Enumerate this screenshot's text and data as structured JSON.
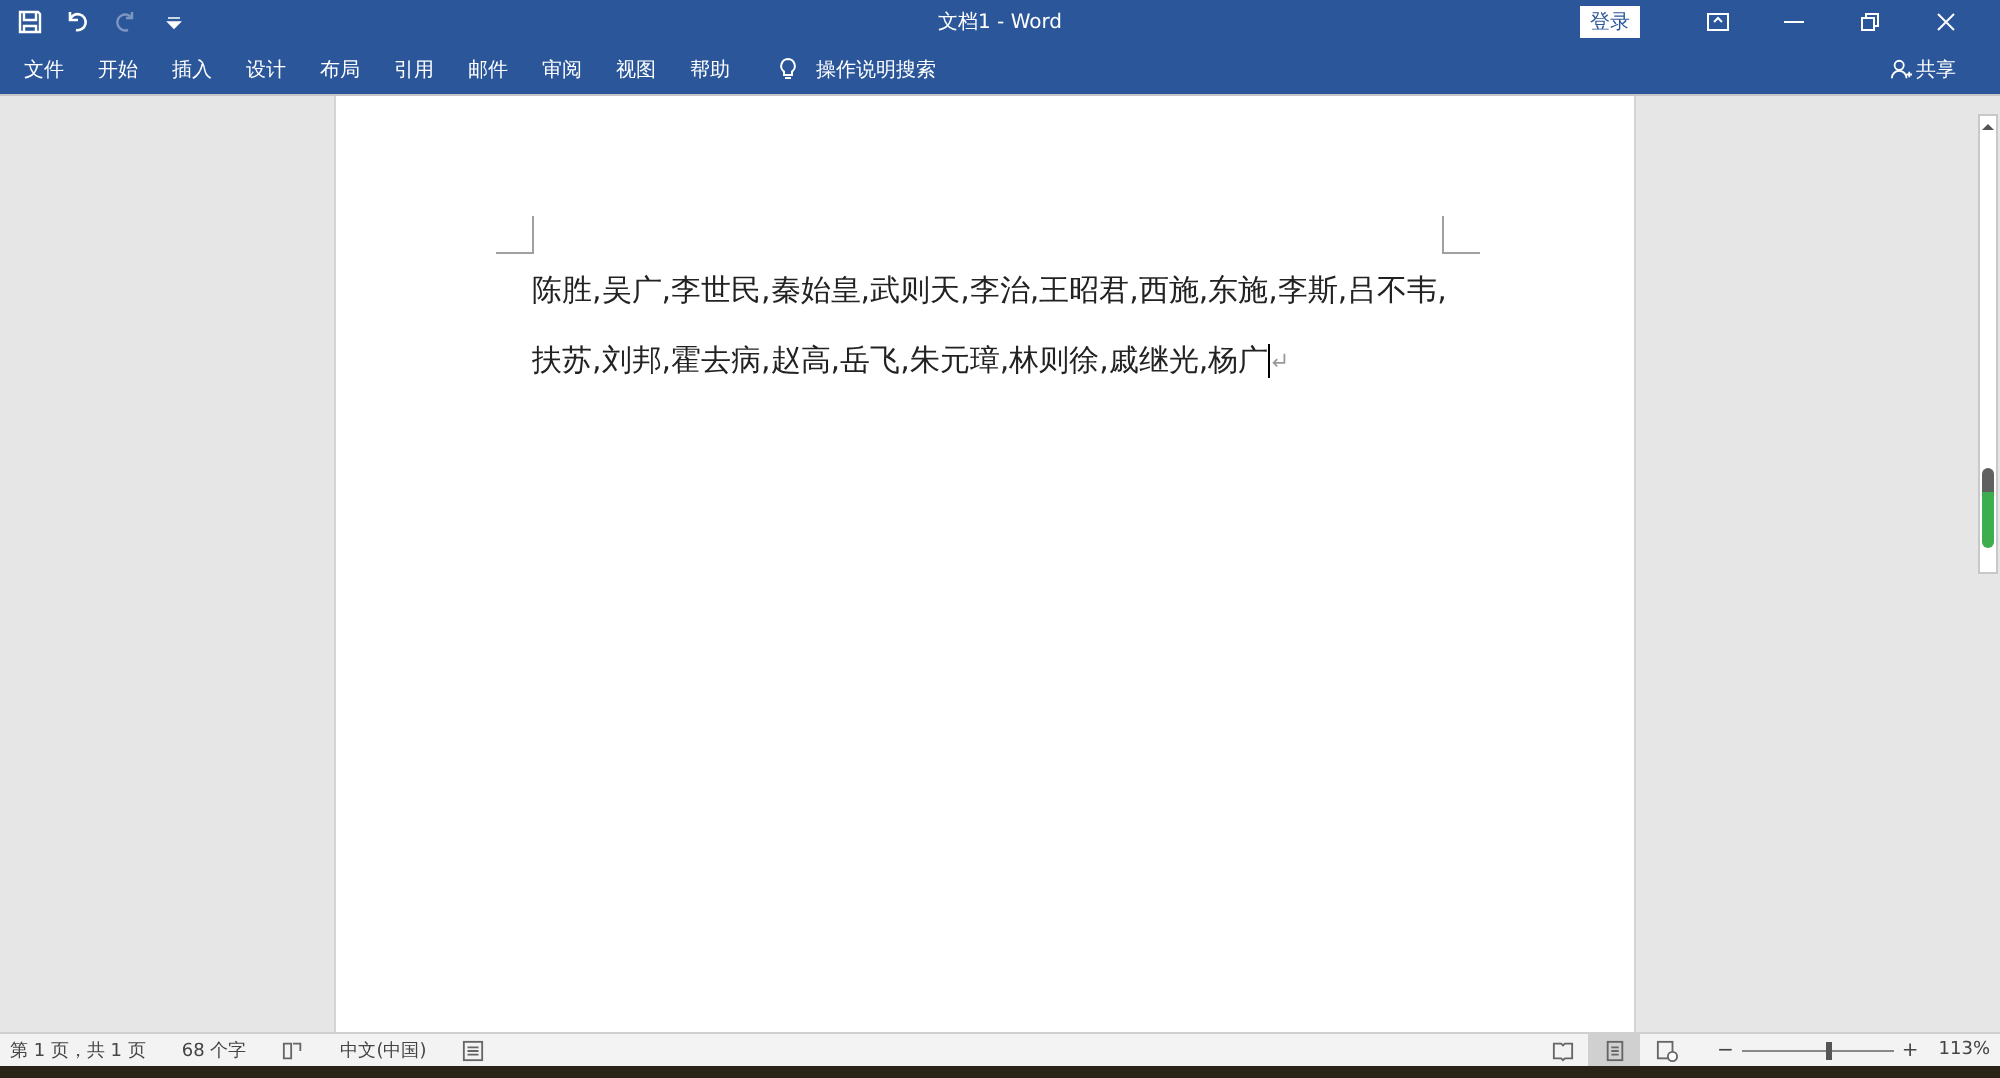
{
  "window": {
    "title": "文档1 - Word",
    "sign_in": "登录"
  },
  "menu_tabs": [
    {
      "label": "文件",
      "selected": false
    },
    {
      "label": "开始",
      "selected": false
    },
    {
      "label": "插入",
      "selected": false
    },
    {
      "label": "设计",
      "selected": false
    },
    {
      "label": "布局",
      "selected": false
    },
    {
      "label": "引用",
      "selected": false
    },
    {
      "label": "邮件",
      "selected": false
    },
    {
      "label": "审阅",
      "selected": false
    },
    {
      "label": "视图",
      "selected": false
    },
    {
      "label": "帮助",
      "selected": false
    }
  ],
  "tell_me": {
    "placeholder": "操作说明搜索"
  },
  "share": "共享",
  "document": {
    "lines": [
      "陈胜,吴广,李世民,秦始皇,武则天,李治,王昭君,西施,东施,李斯,吕不韦,",
      "扶苏,刘邦,霍去病,赵高,岳飞,朱元璋,林则徐,戚继光,杨广"
    ]
  },
  "status_bar": {
    "page": "第 1 页，共 1 页",
    "word_count": "68 个字",
    "language": "中文(中国)",
    "views": [
      {
        "kind": "read",
        "selected": false
      },
      {
        "kind": "print",
        "selected": true
      },
      {
        "kind": "web",
        "selected": false
      }
    ],
    "zoom_minus": "−",
    "zoom_plus": "+",
    "zoom": {
      "level": 0.57
    },
    "zoom_reading": "113%"
  }
}
